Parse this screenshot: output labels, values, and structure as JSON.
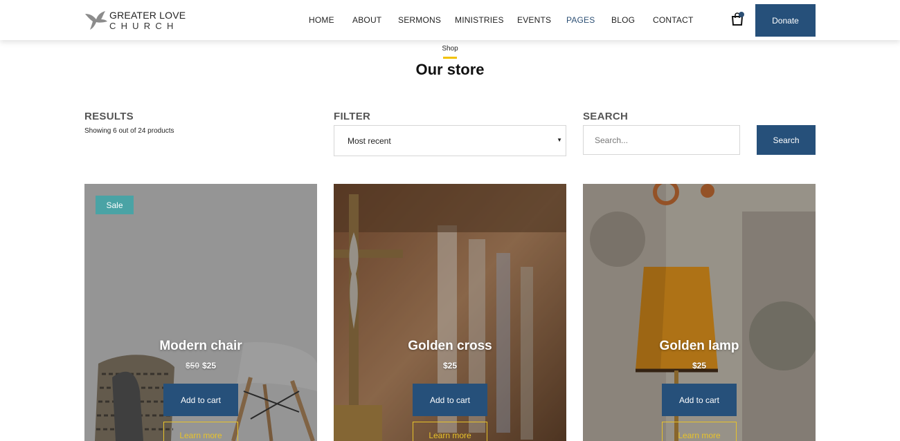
{
  "brand": {
    "name_line1": "GREATER LOVE",
    "name_line2": "CHURCH",
    "logo_icon": "dove-icon"
  },
  "nav": {
    "items": [
      {
        "label": "HOME",
        "active": false
      },
      {
        "label": "ABOUT",
        "active": false
      },
      {
        "label": "SERMONS",
        "active": false
      },
      {
        "label": "MINISTRIES",
        "active": false
      },
      {
        "label": "EVENTS",
        "active": false
      },
      {
        "label": "PAGES",
        "active": true
      },
      {
        "label": "BLOG",
        "active": false
      },
      {
        "label": "CONTACT",
        "active": false
      }
    ],
    "cart_icon": "shopping-bag-icon",
    "donate_label": "Donate"
  },
  "page": {
    "eyebrow": "Shop",
    "title": "Our store"
  },
  "toolbar": {
    "results_label": "RESULTS",
    "results_text": "Showing 6 out of 24 products",
    "filter_label": "FILTER",
    "filter_value": "Most recent",
    "search_label": "SEARCH",
    "search_placeholder": "Search...",
    "search_button": "Search"
  },
  "products": [
    {
      "name": "Modern chair",
      "old_price": "$50",
      "price": "$25",
      "badge": "Sale",
      "add_label": "Add to cart",
      "learn_label": "Learn more"
    },
    {
      "name": "Golden cross",
      "old_price": "",
      "price": "$25",
      "badge": "",
      "add_label": "Add to cart",
      "learn_label": "Learn more"
    },
    {
      "name": "Golden lamp",
      "old_price": "",
      "price": "$25",
      "badge": "",
      "add_label": "Add to cart",
      "learn_label": "Learn more"
    }
  ],
  "colors": {
    "primary": "#26507a",
    "accent": "#f2c200",
    "sale": "#4aa3a5",
    "outline": "#e8c32a"
  }
}
